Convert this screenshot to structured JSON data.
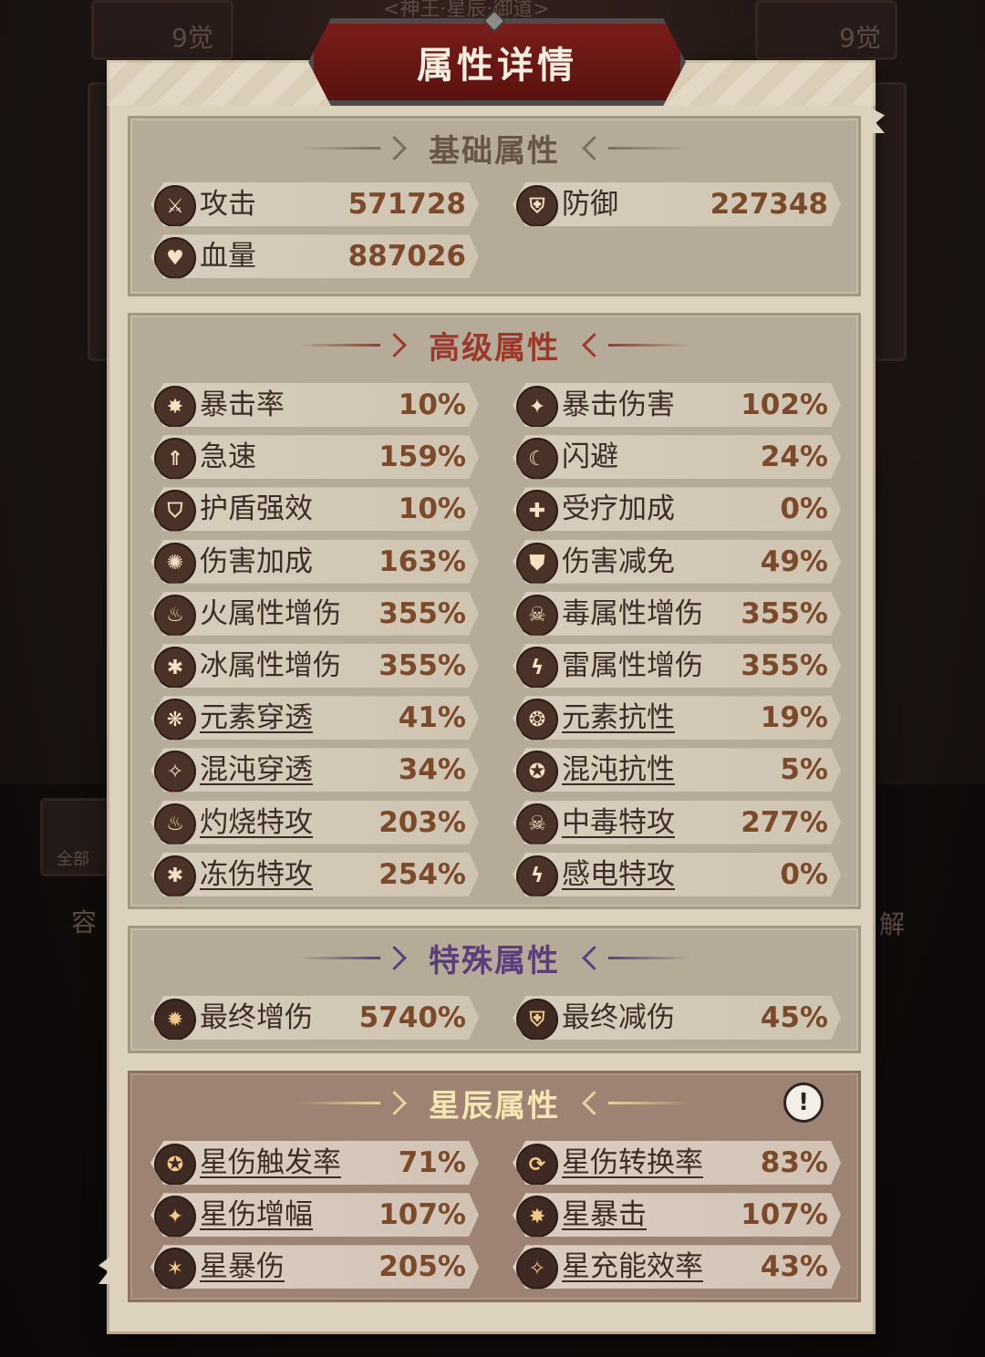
{
  "background": {
    "top_left_badge": "9觉",
    "top_right_badge": "9觉",
    "top_banner": "<神王·星辰·御道>",
    "left_tab": "全部",
    "left_side_text": "容",
    "right_side_text": "解"
  },
  "dialog": {
    "title": "属性详情"
  },
  "sections": {
    "basic": {
      "title": "基础属性",
      "title_color": "#6b5a50",
      "items": [
        {
          "icon": "sword-icon",
          "glyph": "⚔",
          "label": "攻击",
          "value": "571728"
        },
        {
          "icon": "shield-icon",
          "glyph": "⛨",
          "label": "防御",
          "value": "227348"
        },
        {
          "icon": "heart-icon",
          "glyph": "♥",
          "label": "血量",
          "value": "887026"
        }
      ]
    },
    "advanced": {
      "title": "高级属性",
      "title_color": "#9a3a2c",
      "items": [
        {
          "icon": "crit-burst-icon",
          "glyph": "✸",
          "label": "暴击率",
          "value": "10%"
        },
        {
          "icon": "crit-damage-icon",
          "glyph": "✦",
          "label": "暴击伤害",
          "value": "102%"
        },
        {
          "icon": "haste-icon",
          "glyph": "⇑",
          "label": "急速",
          "value": "159%"
        },
        {
          "icon": "dodge-moon-icon",
          "glyph": "☾",
          "label": "闪避",
          "value": "24%"
        },
        {
          "icon": "shield-boost-icon",
          "glyph": "⛉",
          "label": "护盾强效",
          "value": "10%"
        },
        {
          "icon": "healing-cross-icon",
          "glyph": "✚",
          "label": "受疗加成",
          "value": "0%"
        },
        {
          "icon": "damage-bonus-icon",
          "glyph": "✺",
          "label": "伤害加成",
          "value": "163%"
        },
        {
          "icon": "damage-reduction-icon",
          "glyph": "⛊",
          "label": "伤害减免",
          "value": "49%"
        },
        {
          "icon": "fire-icon",
          "glyph": "♨",
          "label": "火属性增伤",
          "value": "355%"
        },
        {
          "icon": "poison-skull-icon",
          "glyph": "☠",
          "label": "毒属性增伤",
          "value": "355%"
        },
        {
          "icon": "ice-icon",
          "glyph": "✱",
          "label": "冰属性增伤",
          "value": "355%"
        },
        {
          "icon": "lightning-icon",
          "glyph": "ϟ",
          "label": "雷属性增伤",
          "value": "355%"
        },
        {
          "icon": "element-pierce-icon",
          "glyph": "❋",
          "label": "元素穿透",
          "value": "41%",
          "underline": true
        },
        {
          "icon": "element-resist-icon",
          "glyph": "❂",
          "label": "元素抗性",
          "value": "19%",
          "underline": true
        },
        {
          "icon": "chaos-pierce-icon",
          "glyph": "✧",
          "label": "混沌穿透",
          "value": "34%",
          "underline": true
        },
        {
          "icon": "chaos-resist-icon",
          "glyph": "✪",
          "label": "混沌抗性",
          "value": "5%",
          "underline": true
        },
        {
          "icon": "burn-icon",
          "glyph": "♨",
          "label": "灼烧特攻",
          "value": "203%",
          "underline": true
        },
        {
          "icon": "poison-attack-icon",
          "glyph": "☠",
          "label": "中毒特攻",
          "value": "277%",
          "underline": true
        },
        {
          "icon": "frostbite-icon",
          "glyph": "✱",
          "label": "冻伤特攻",
          "value": "254%",
          "underline": true
        },
        {
          "icon": "shock-icon",
          "glyph": "ϟ",
          "label": "感电特攻",
          "value": "0%",
          "underline": true
        }
      ]
    },
    "special": {
      "title": "特殊属性",
      "title_color": "#5b3f7a",
      "items": [
        {
          "icon": "final-damage-icon",
          "glyph": "✹",
          "label": "最终增伤",
          "value": "5740%"
        },
        {
          "icon": "final-reduction-icon",
          "glyph": "⛨",
          "label": "最终减伤",
          "value": "45%"
        }
      ]
    },
    "star": {
      "title": "星辰属性",
      "title_color": "#f3e3b0",
      "info_glyph": "!",
      "items": [
        {
          "icon": "star-trigger-icon",
          "glyph": "✪",
          "label": "星伤触发率",
          "value": "71%",
          "underline": true
        },
        {
          "icon": "star-convert-icon",
          "glyph": "⟳",
          "label": "星伤转换率",
          "value": "83%",
          "underline": true
        },
        {
          "icon": "star-amplify-icon",
          "glyph": "✦",
          "label": "星伤增幅",
          "value": "107%",
          "underline": true
        },
        {
          "icon": "star-crit-icon",
          "glyph": "✸",
          "label": "星暴击",
          "value": "107%",
          "underline": true
        },
        {
          "icon": "star-crit-damage-icon",
          "glyph": "✶",
          "label": "星暴伤",
          "value": "205%",
          "underline": true
        },
        {
          "icon": "star-charge-icon",
          "glyph": "✧",
          "label": "星充能效率",
          "value": "43%",
          "underline": true
        }
      ]
    }
  }
}
